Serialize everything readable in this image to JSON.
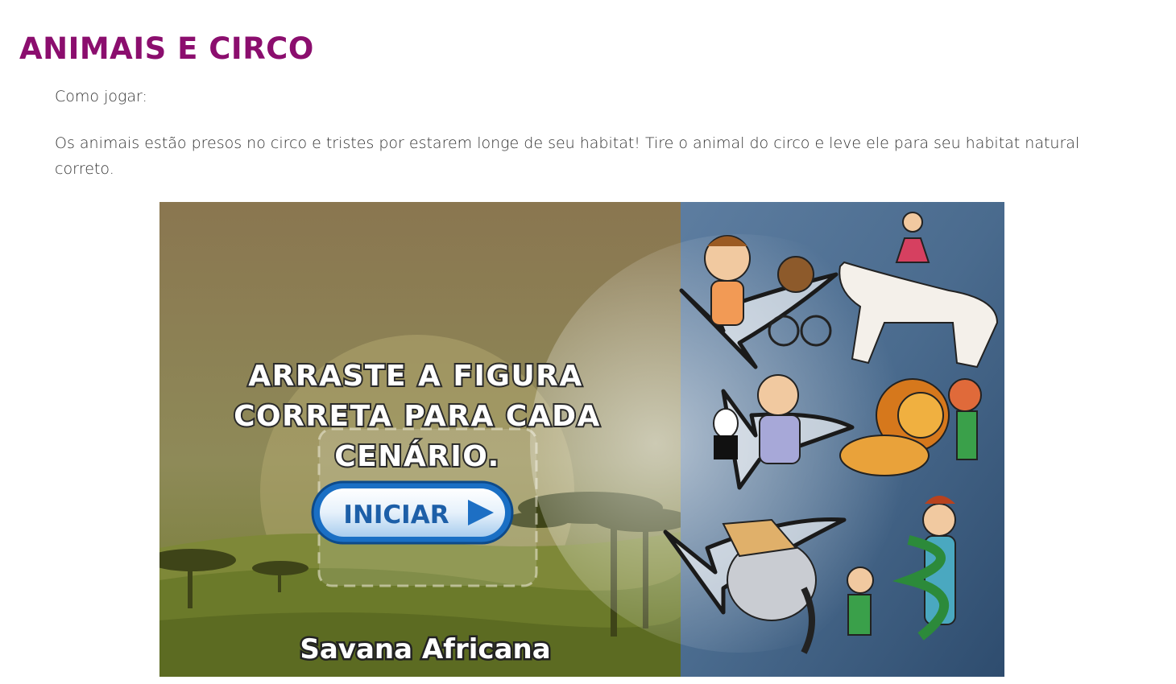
{
  "page": {
    "title": "ANIMAIS E CIRCO",
    "how_to_label": "Como jogar:",
    "description": "Os animais estão presos no circo e tristes por estarem longe de seu habitat! Tire o animal do circo e leve ele para seu habitat natural correto."
  },
  "game": {
    "instruction_lines": [
      "ARRASTE A FIGURA",
      "CORRETA PARA CADA",
      "CENÁRIO."
    ],
    "start_button_label": "INICIAR",
    "scenario_label": "Savana Africana",
    "circus_figures": [
      "boy-and-monkey-on-bicycle",
      "acrobat-on-white-horse",
      "magician-with-rabbit-in-hat",
      "lion-tamer-with-lion",
      "elephant-with-trainer",
      "snake-charmer-dancer"
    ]
  },
  "colors": {
    "title": "#8b0e6e",
    "text": "#333333",
    "savanna_sky": "#8a7a50",
    "savanna_ground": "#6f7a2c",
    "circus_bg": "#3f5f82",
    "button_blue": "#1a6fc4",
    "button_text": "#1d5fa8"
  }
}
